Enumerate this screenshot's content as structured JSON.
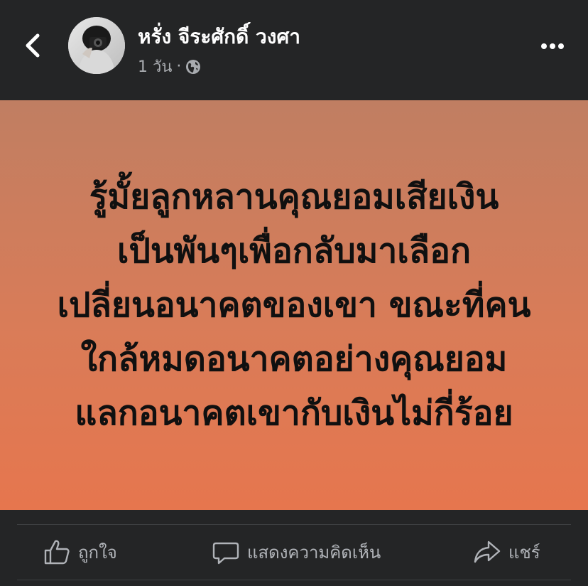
{
  "header": {
    "author_name": "หรั่ง จีระศักดิ์ วงศา",
    "time": "1 วัน",
    "separator": "·",
    "privacy_icon": "globe-icon",
    "back_icon": "chevron-left-icon",
    "more_icon": "more-horizontal-icon"
  },
  "post": {
    "text": "รู้มั้ยลูกหลานคุณยอมเสียเงิน\nเป็นพันๆเพื่อกลับมาเลือก\nเปลี่ยนอนาคตของเขา ขณะที่คน\nใกล้หมดอนาคตอย่างคุณยอม\nแลกอนาคตเขากับเงินไม่กี่ร้อย",
    "background_top": "#c07e62",
    "background_bottom": "#e6764e"
  },
  "actions": {
    "like_label": "ถูกใจ",
    "comment_label": "แสดงความคิดเห็น",
    "share_label": "แชร์"
  },
  "colors": {
    "bar_background": "#242526",
    "secondary_text": "#b0b3b8",
    "primary_text": "#ffffff"
  }
}
